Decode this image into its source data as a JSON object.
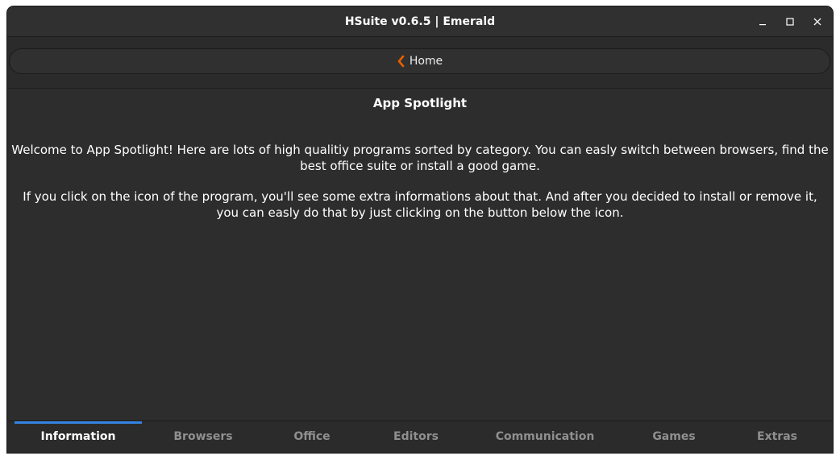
{
  "window": {
    "title": "HSuite v0.6.5 | Emerald",
    "minimize_icon": "minimize-icon",
    "maximize_icon": "maximize-icon",
    "close_icon": "close-icon"
  },
  "nav": {
    "home_label": "Home",
    "home_icon": "chevron-left-icon",
    "accent_color": "#e66100"
  },
  "main": {
    "heading": "App Spotlight",
    "paragraph1": "Welcome to App Spotlight! Here are lots of high qualitiy programs sorted by category. You can easly switch between browsers, find the best office suite or install a good game.",
    "paragraph2": "If you click on the icon of the program, you'll see some extra informations about that. And after you decided to install or remove it, you can easly do that by just clicking on the button below the icon."
  },
  "tabs": [
    {
      "label": "Information",
      "active": true
    },
    {
      "label": "Browsers",
      "active": false
    },
    {
      "label": "Office",
      "active": false
    },
    {
      "label": "Editors",
      "active": false
    },
    {
      "label": "Communication",
      "active": false
    },
    {
      "label": "Games",
      "active": false
    },
    {
      "label": "Extras",
      "active": false
    }
  ],
  "theme": {
    "background": "#2d2d2d",
    "tab_active_indicator": "#3584e4"
  }
}
